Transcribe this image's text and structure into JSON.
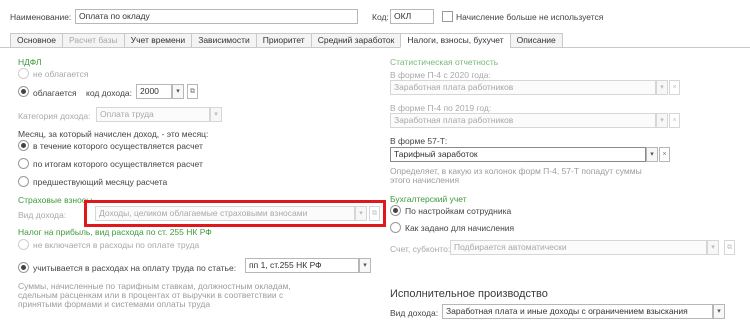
{
  "header": {
    "name_label": "Наименование:",
    "name_value": "Оплата по окладу",
    "code_label": "Код:",
    "code_value": "ОКЛ",
    "obsolete_label": "Начисление больше не используется"
  },
  "tabs": [
    {
      "label": "Основное",
      "state": "normal"
    },
    {
      "label": "Расчет базы",
      "state": "disabled"
    },
    {
      "label": "Учет времени",
      "state": "normal"
    },
    {
      "label": "Зависимости",
      "state": "normal"
    },
    {
      "label": "Приоритет",
      "state": "normal"
    },
    {
      "label": "Средний заработок",
      "state": "normal"
    },
    {
      "label": "Налоги, взносы, бухучет",
      "state": "active"
    },
    {
      "label": "Описание",
      "state": "normal"
    }
  ],
  "ndfl": {
    "title": "НДФЛ",
    "not_taxed": "не облагается",
    "taxed": "облагается",
    "income_code_label": "код дохода:",
    "income_code_value": "2000",
    "income_category_label": "Категория дохода:",
    "income_category_value": "Оплата труда",
    "month_title": "Месяц, за который начислен доход, - это месяц:",
    "month_opt1": "в течение которого осуществляется расчет",
    "month_opt2": "по итогам которого осуществляется расчет",
    "month_opt3": "предшествующий месяцу расчета"
  },
  "insurance": {
    "title": "Страховые взносы",
    "income_type_label": "Вид дохода:",
    "income_type_value": "Доходы, целиком облагаемые страховыми взносами"
  },
  "profit_tax": {
    "title": "Налог на прибыль, вид расхода по ст. 255 НК РФ",
    "opt_excluded": "не включается в расходы по оплате труда",
    "opt_included": "учитывается в расходах на оплату труда по статье:",
    "article_value": "пп 1, ст.255 НК РФ",
    "note": "Суммы, начисленные по тарифным ставкам, должностным окладам, сдельным расценкам или в процентах от выручки в соответствии с принятыми формами и системами оплаты труда"
  },
  "stats": {
    "title": "Статистическая отчетность",
    "p4_2020_label": "В форме П-4 с 2020 года:",
    "p4_2020_value": "Заработная плата работников",
    "p4_2019_label": "В форме П-4 по 2019 год:",
    "p4_2019_value": "Заработная плата работников",
    "f57_label": "В форме 57-Т:",
    "f57_value": "Тарифный заработок",
    "note": "Определяет, в какую из колонок форм П-4, 57-Т попадут суммы этого начисления"
  },
  "accounting": {
    "title": "Бухгалтерский учет",
    "opt_employee": "По настройкам сотрудника",
    "opt_accrual": "Как задано для начисления",
    "account_label": "Счет, субконто:",
    "account_placeholder": "Подбирается автоматически"
  },
  "enforcement": {
    "title": "Исполнительное производство",
    "income_type_label": "Вид дохода:",
    "income_type_value": "Заработная плата и иные доходы с ограничением взыскания"
  },
  "colors": {
    "section_title": "#3e9a3b",
    "highlight_frame": "#e0171d",
    "disabled_text": "#a8a8a8"
  },
  "icons": {
    "dropdown": "▾",
    "clear": "×",
    "open": "⧉"
  }
}
